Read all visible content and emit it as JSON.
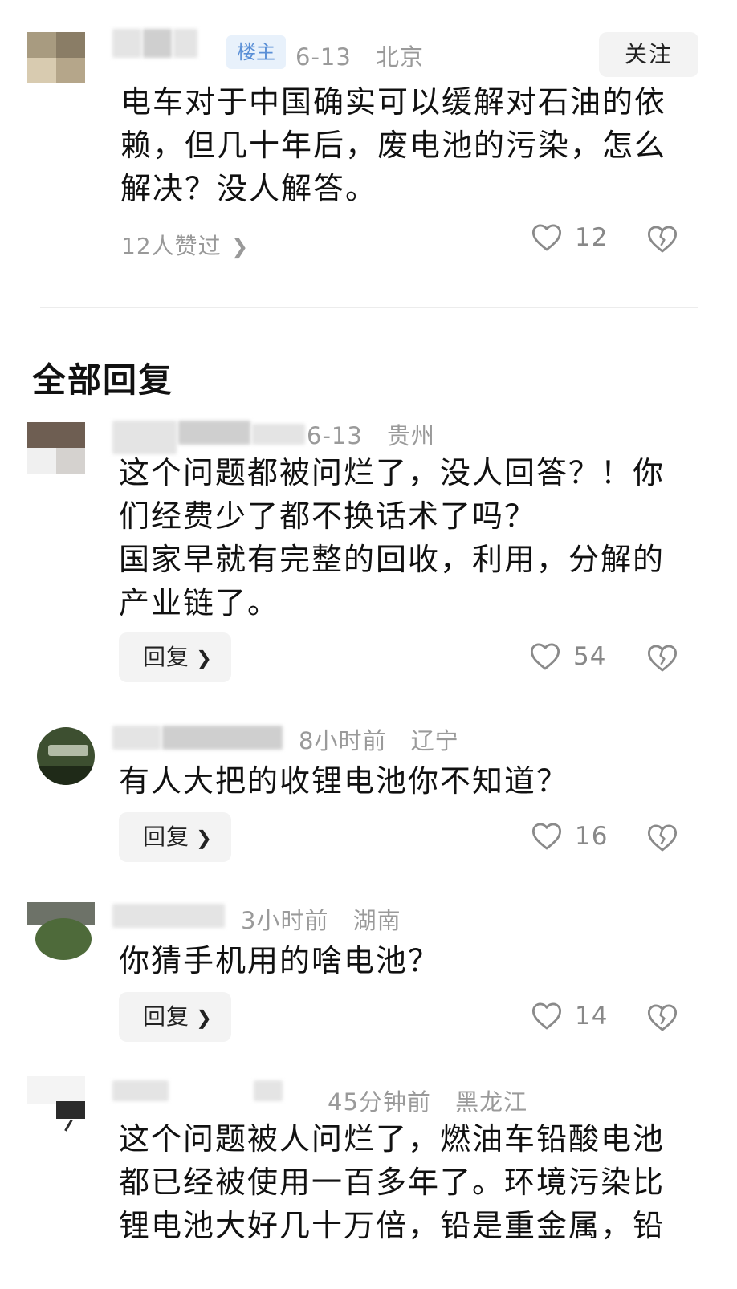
{
  "post": {
    "badge": "楼主",
    "date": "6-13",
    "location": "北京",
    "follow_label": "关注",
    "text": "电车对于中国确实可以缓解对石油的依\n赖，但几十年后，废电池的污染，怎么\n解决？没人解答。",
    "liked_by": "12人赞过",
    "like_count": "12"
  },
  "section_title": "全部回复",
  "replies": [
    {
      "time": "6-13",
      "location": "贵州",
      "text": "这个问题都被问烂了，没人回答？！你\n们经费少了都不换话术了吗？\n国家早就有完整的回收，利用，分解的\n产业链了。",
      "reply_label": "回复",
      "like_count": "54"
    },
    {
      "time": "8小时前",
      "location": "辽宁",
      "text": "有人大把的收锂电池你不知道？",
      "reply_label": "回复",
      "like_count": "16"
    },
    {
      "time": "3小时前",
      "location": "湖南",
      "text": "你猜手机用的啥电池？",
      "reply_label": "回复",
      "like_count": "14"
    },
    {
      "time": "45分钟前",
      "location": "黑龙江",
      "text": "这个问题被人问烂了，燃油车铅酸电池\n都已经被使用一百多年了。环境污染比\n锂电池大好几十万倍，铅是重金属，铅",
      "reply_label": "",
      "like_count": ""
    }
  ],
  "icons": {
    "like": "heart-outline-icon",
    "dislike": "broken-heart-icon",
    "chevron": "chevron-right-icon"
  },
  "colors": {
    "badge_bg": "#e8f1fb",
    "badge_text": "#5a8fd6",
    "meta_gray": "#9a9a9a",
    "button_bg": "#f3f3f3"
  }
}
